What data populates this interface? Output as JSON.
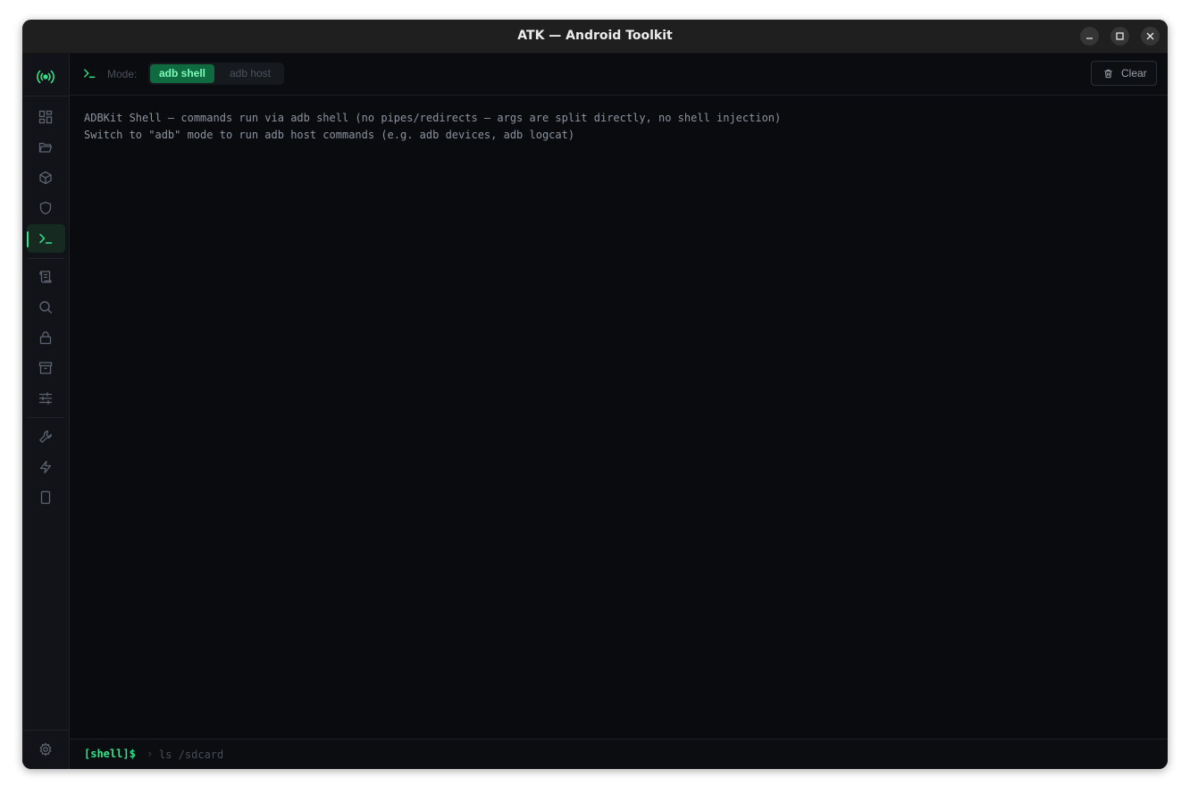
{
  "window": {
    "title": "ATK — Android Toolkit"
  },
  "sidebar": {
    "items": [
      {
        "icon": "dashboard-icon"
      },
      {
        "icon": "folder-icon"
      },
      {
        "icon": "package-icon"
      },
      {
        "icon": "shield-icon"
      },
      {
        "icon": "terminal-icon",
        "active": true
      },
      {
        "icon": "scroll-icon"
      },
      {
        "icon": "search-icon"
      },
      {
        "icon": "lock-icon"
      },
      {
        "icon": "archive-icon"
      },
      {
        "icon": "sliders-icon"
      },
      {
        "icon": "wrench-icon"
      },
      {
        "icon": "zap-icon"
      },
      {
        "icon": "smartphone-icon"
      },
      {
        "icon": "settings-icon"
      }
    ]
  },
  "toolbar": {
    "mode_label": "Mode:",
    "modes": [
      "adb shell",
      "adb host"
    ],
    "active_mode": "adb shell",
    "clear_label": "Clear"
  },
  "output": {
    "lines": [
      "ADBKit Shell — commands run via adb shell (no pipes/redirects — args are split directly, no shell injection)",
      "Switch to \"adb\" mode to run adb host commands (e.g. adb devices, adb logcat)"
    ]
  },
  "input": {
    "prompt": "[shell]$",
    "caret": "›",
    "value": "",
    "placeholder": "ls /sdcard"
  },
  "colors": {
    "accent": "#2ee58a",
    "active_mode_bg": "#0f6b3f",
    "background": "#0a0b0f",
    "sidebar_bg": "#111318"
  }
}
